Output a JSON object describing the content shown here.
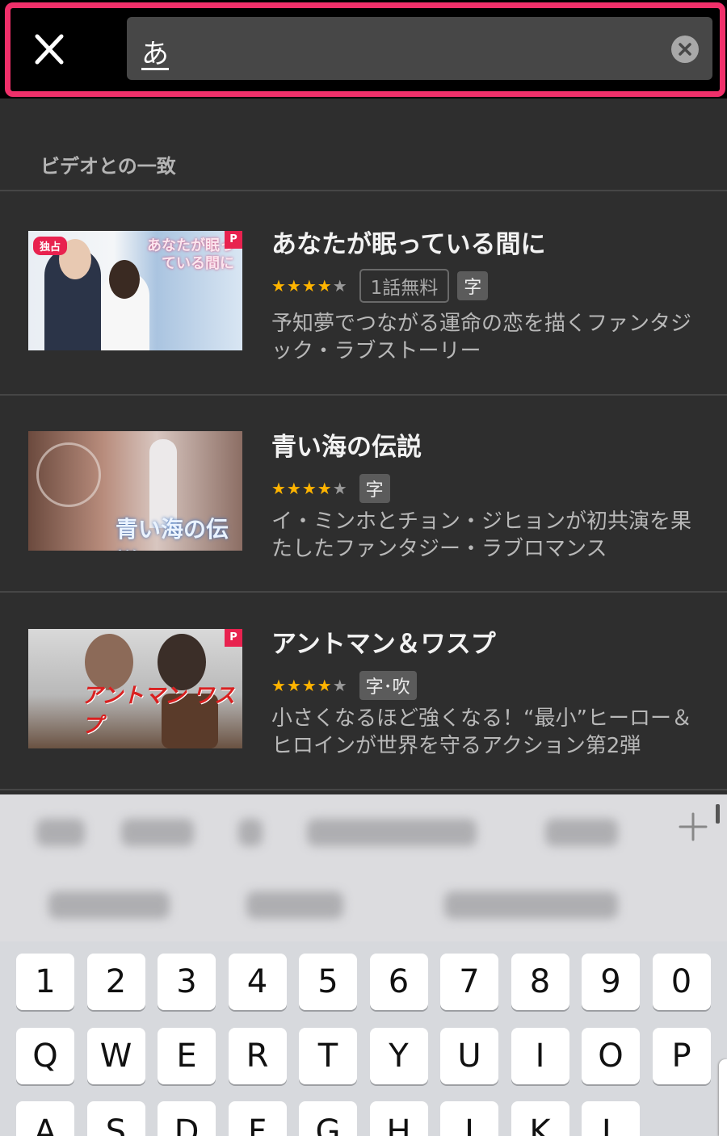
{
  "search": {
    "query": "あ",
    "close_icon": "close-icon",
    "clear_icon": "clear-icon"
  },
  "results": {
    "section_title": "ビデオとの一致",
    "items": [
      {
        "title": "あなたが眠っている間に",
        "rating": 4.5,
        "stars": "★★★★",
        "free_badge": "1話無料",
        "subtitle_badge": "字",
        "description": "予知夢でつながる運命の恋を描くファンタジック・ラブストーリー",
        "thumb_title": "あなたが眠っている間に",
        "thumb_exclusive": "独占",
        "thumb_mark": "P"
      },
      {
        "title": "青い海の伝説",
        "rating": 4.5,
        "stars": "★★★★",
        "subtitle_badge": "字",
        "description": "イ・ミンホとチョン・ジヒョンが初共演を果たしたファンタジー・ラブロマンス",
        "thumb_title": "青い海の伝説"
      },
      {
        "title": "アントマン＆ワスプ",
        "rating": 4,
        "stars": "★★★★",
        "subtitle_badge": "字･吹",
        "description": "小さくなるほど強くなる！“最小”ヒーロー＆ヒロインが世界を守るアクション第2弾",
        "thumb_title": "アントマン ワスプ",
        "thumb_mark": "P"
      }
    ]
  },
  "keyboard": {
    "number_row": [
      "1",
      "2",
      "3",
      "4",
      "5",
      "6",
      "7",
      "8",
      "9",
      "0"
    ],
    "letter_row": [
      "Q",
      "W",
      "E",
      "R",
      "T",
      "Y",
      "U",
      "I",
      "O",
      "P"
    ],
    "third_row_partial": [
      "A",
      "S",
      "D",
      "F",
      "G",
      "H",
      "J",
      "K",
      "L"
    ],
    "plus_icon": "plus-icon"
  },
  "colors": {
    "highlight": "#f0306a",
    "star": "#ffb400",
    "background": "#2e2e2e"
  }
}
